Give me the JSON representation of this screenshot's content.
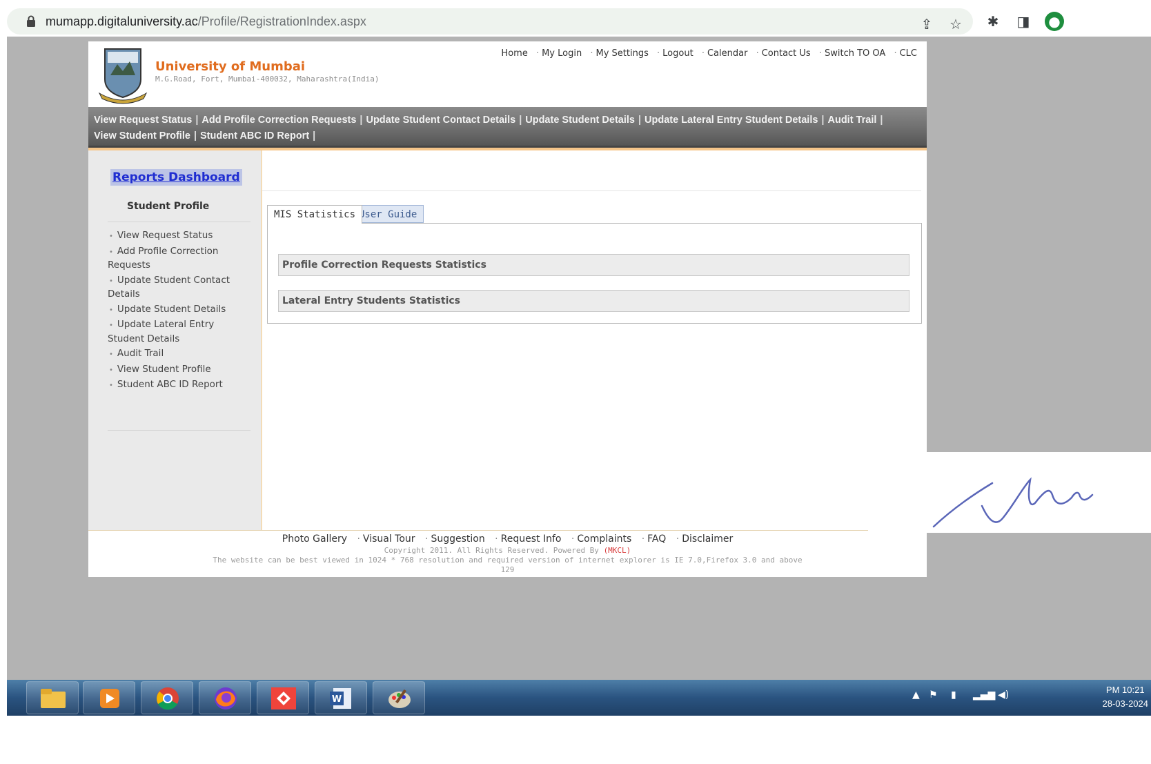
{
  "browser": {
    "url_domain": "mumapp.digitaluniversity.ac",
    "url_path": "/Profile/RegistrationIndex.aspx",
    "icons": [
      "lock-icon",
      "share-icon",
      "star-icon",
      "extensions-icon",
      "sidepanel-icon",
      "profile-icon"
    ]
  },
  "header": {
    "university_name": "University of Mumbai",
    "address": "M.G.Road, Fort, Mumbai-400032, Maharashtra(India)",
    "top_links": [
      "Home",
      "My Login",
      "My Settings",
      "Logout",
      "Calendar",
      "Contact Us",
      "Switch TO OA",
      "CLC"
    ]
  },
  "navbar": {
    "row1": [
      "View Request Status",
      "Add Profile Correction Requests",
      "Update Student Contact Details",
      "Update Student Details",
      "Update Lateral Entry Student Details",
      "Audit Trail"
    ],
    "row2": [
      "View Student Profile",
      "Student ABC ID Report"
    ],
    "separator": "|"
  },
  "sidebar": {
    "dashboard_label": "Reports Dashboard",
    "section_title": "Student Profile",
    "items": [
      "View Request Status",
      "Add Profile Correction Requests",
      "Update Student Contact Details",
      "Update Student Details",
      "Update Lateral Entry Student Details",
      "Audit Trail",
      "View Student Profile",
      "Student ABC ID Report"
    ]
  },
  "main": {
    "tabs": [
      {
        "label": "MIS Statistics",
        "active": true
      },
      {
        "label": "User Guide",
        "active": false
      }
    ],
    "statistics": [
      "Profile Correction Requests Statistics",
      "Lateral Entry Students Statistics"
    ]
  },
  "footer": {
    "links": [
      "Photo Gallery",
      "Visual Tour",
      "Suggestion",
      "Request Info",
      "Complaints",
      "FAQ",
      "Disclaimer"
    ],
    "copyright": "Copyright 2011. All Rights Reserved. Powered By",
    "powered_by": "(MKCL)",
    "resolution_note": "The website can be best viewed in 1024 * 768 resolution and required version of internet explorer is IE 7.0,Firefox 3.0 and above",
    "counter": "129"
  },
  "taskbar": {
    "apps": [
      "file-explorer-icon",
      "media-player-icon",
      "chrome-icon",
      "firefox-icon",
      "anydesk-icon",
      "word-icon",
      "paint-icon"
    ],
    "time": "PM 10:21",
    "date": "28-03-2024"
  },
  "colors": {
    "brand_orange": "#e06c1e",
    "nav_gray": "#6f6f6f",
    "dashboard_blue": "#1f2dd1",
    "taskbar_blue": "#2a5380"
  }
}
